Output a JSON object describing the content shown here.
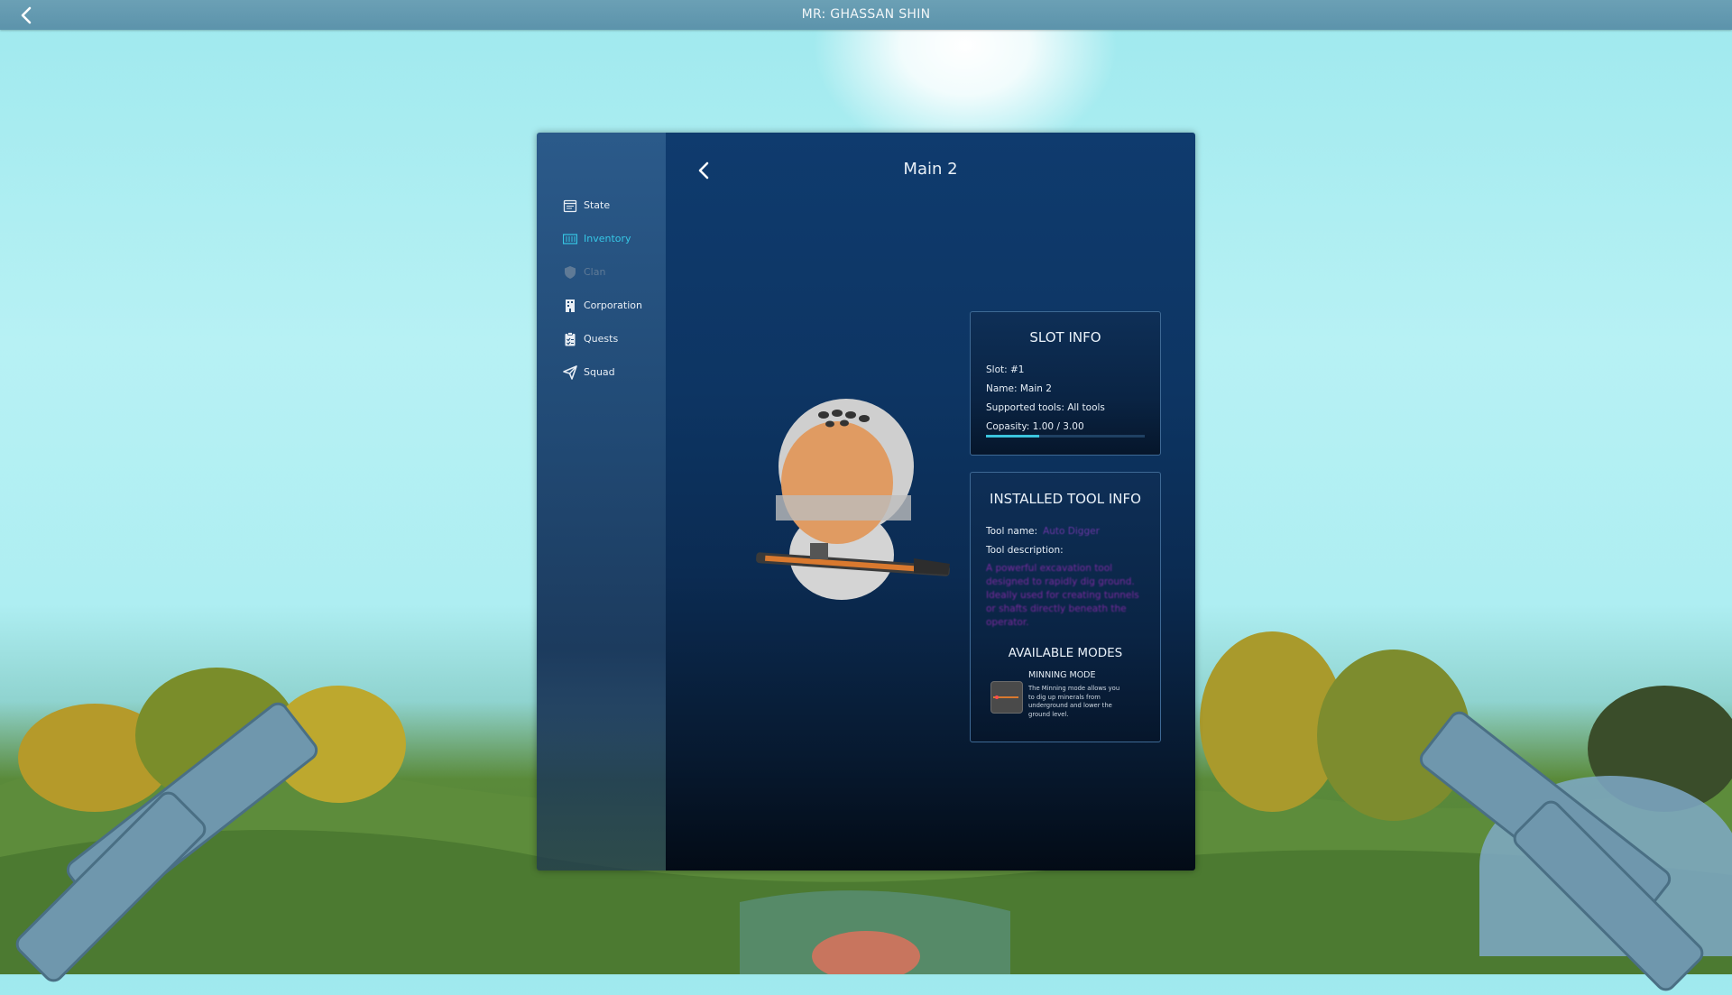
{
  "topbar": {
    "title": "MR: GHASSAN SHIN",
    "back_icon": "chevron-left-icon"
  },
  "sidebar": {
    "items": [
      {
        "label": "State",
        "icon": "calendar-icon",
        "state": "normal"
      },
      {
        "label": "Inventory",
        "icon": "inventory-grid-icon",
        "state": "active"
      },
      {
        "label": "Clan",
        "icon": "shield-icon",
        "state": "disabled"
      },
      {
        "label": "Corporation",
        "icon": "building-icon",
        "state": "normal"
      },
      {
        "label": "Quests",
        "icon": "clipboard-icon",
        "state": "normal"
      },
      {
        "label": "Squad",
        "icon": "send-icon",
        "state": "normal"
      }
    ],
    "active_color": "#36c7e6"
  },
  "content": {
    "title": "Main 2",
    "back_icon": "chevron-left-icon"
  },
  "slot_info": {
    "title": "SLOT INFO",
    "slot": "Slot: #1",
    "name": "Name: Main 2",
    "supported": "Supported tools: All tools",
    "capacity": "Copasity: 1.00 / 3.00",
    "capacity_fraction": 0.333
  },
  "tool_info": {
    "title": "INSTALLED TOOL INFO",
    "tool_name_label": "Tool name:",
    "tool_name_value": "Auto Digger",
    "tool_desc_label": "Tool description:",
    "tool_desc_value": "A powerful excavation tool designed to rapidly dig ground. Ideally used for creating tunnels or shafts directly beneath the operator.",
    "modes_title": "AVAILABLE MODES",
    "mode_name": "MINNING MODE",
    "mode_desc": "The Minning mode allows you to dig up minerals from underground and lower the ground level."
  }
}
